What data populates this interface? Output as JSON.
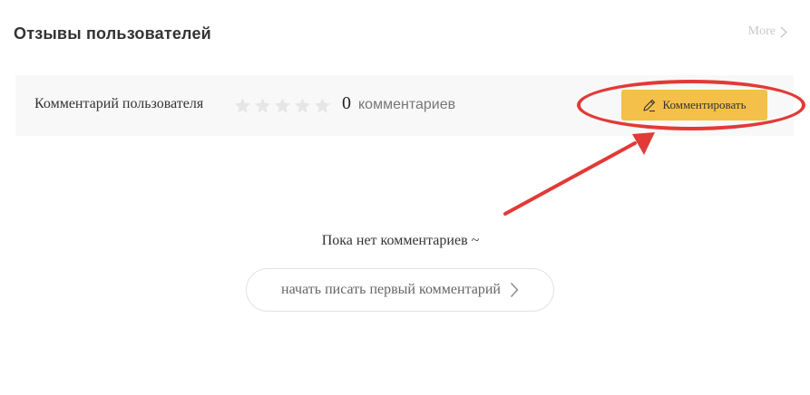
{
  "header": {
    "title": "Отзывы пользователей",
    "more_label": "More",
    "more_icon": "chevron-right-icon"
  },
  "rating_bar": {
    "label": "Комментарий пользователя",
    "stars_total": 5,
    "stars_filled": 0,
    "star_icon": "star-icon",
    "count": "0",
    "count_label": "комментариев",
    "comment_button": {
      "label": "Комментировать",
      "icon": "pencil-icon"
    }
  },
  "empty_state": {
    "text": "Пока нет комментариев ~",
    "write_first_label": "начать писать первый комментарий",
    "write_first_icon": "chevron-right-icon"
  },
  "annotation": {
    "color": "#e23a36"
  },
  "colors": {
    "accent": "#f4c04a",
    "bar_bg": "#f8f8f8",
    "star_empty": "#e6e6e6"
  }
}
